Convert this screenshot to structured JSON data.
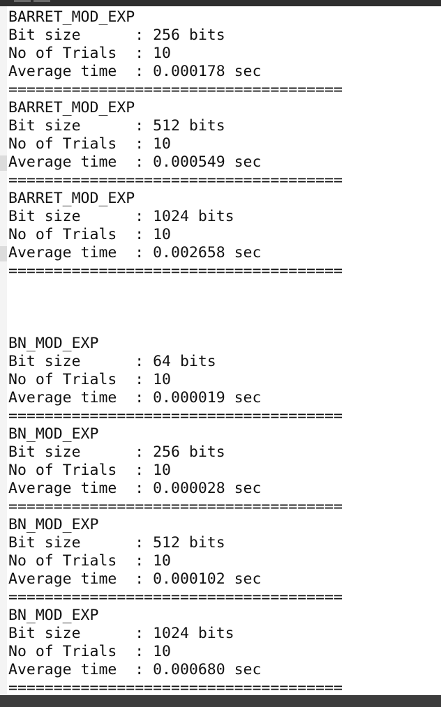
{
  "terminal": {
    "lines": [
      "BARRET_MOD_EXP",
      "Bit size      : 256 bits",
      "No of Trials  : 10",
      "Average time  : 0.000178 sec",
      "=====================================",
      "BARRET_MOD_EXP",
      "Bit size      : 512 bits",
      "No of Trials  : 10",
      "Average time  : 0.000549 sec",
      "=====================================",
      "BARRET_MOD_EXP",
      "Bit size      : 1024 bits",
      "No of Trials  : 10",
      "Average time  : 0.002658 sec",
      "=====================================",
      "",
      "",
      "",
      "BN_MOD_EXP",
      "Bit size      : 64 bits",
      "No of Trials  : 10",
      "Average time  : 0.000019 sec",
      "=====================================",
      "BN_MOD_EXP",
      "Bit size      : 256 bits",
      "No of Trials  : 10",
      "Average time  : 0.000028 sec",
      "=====================================",
      "BN_MOD_EXP",
      "Bit size      : 512 bits",
      "No of Trials  : 10",
      "Average time  : 0.000102 sec",
      "=====================================",
      "BN_MOD_EXP",
      "Bit size      : 1024 bits",
      "No of Trials  : 10",
      "Average time  : 0.000680 sec",
      "====================================="
    ]
  }
}
